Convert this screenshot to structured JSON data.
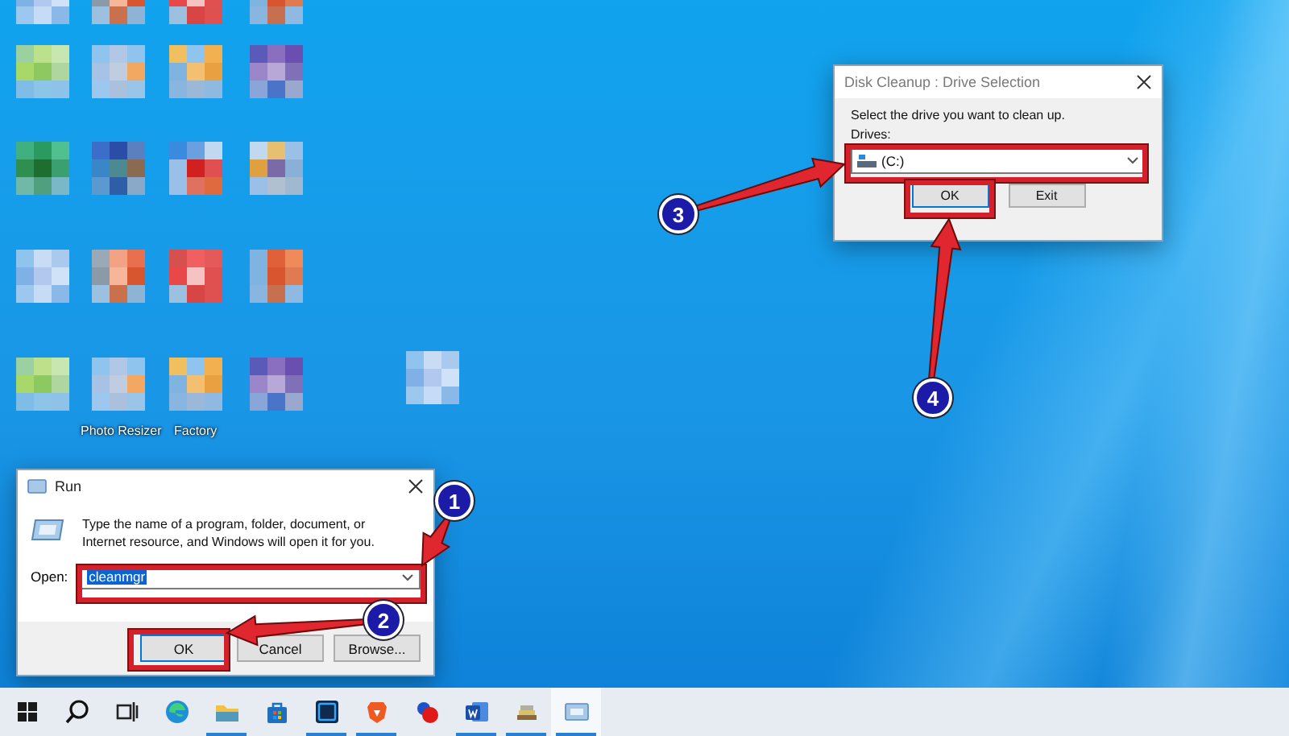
{
  "desktop_icons": [
    {
      "label": "Photo Resizer"
    },
    {
      "label": "Factory"
    }
  ],
  "run_dialog": {
    "title": "Run",
    "message": "Type the name of a program, folder, document, or Internet resource, and Windows will open it for you.",
    "open_label": "Open:",
    "open_value": "cleanmgr",
    "value_selected": true,
    "buttons": [
      {
        "label": "OK",
        "highlighted": true
      },
      {
        "label": "Cancel",
        "highlighted": false
      },
      {
        "label": "Browse...",
        "highlighted": false
      }
    ]
  },
  "disk_cleanup_dialog": {
    "title": "Disk Cleanup : Drive Selection",
    "prompt": "Select the drive you want to clean up.",
    "drives_label": "Drives:",
    "drive_value": "(C:)",
    "buttons": [
      {
        "label": "OK",
        "highlighted": true
      },
      {
        "label": "Exit",
        "highlighted": false
      }
    ]
  },
  "step_markers": [
    {
      "number": "1"
    },
    {
      "number": "2"
    },
    {
      "number": "3"
    },
    {
      "number": "4"
    }
  ],
  "taskbar": {
    "items": [
      {
        "kind": "start",
        "open": false,
        "selected": false
      },
      {
        "kind": "search",
        "open": false,
        "selected": false
      },
      {
        "kind": "taskview",
        "open": false,
        "selected": false
      },
      {
        "kind": "edge",
        "open": false,
        "selected": false
      },
      {
        "kind": "explorer",
        "open": true,
        "selected": false
      },
      {
        "kind": "store",
        "open": false,
        "selected": false
      },
      {
        "kind": "photoshop",
        "open": true,
        "selected": false
      },
      {
        "kind": "brave",
        "open": true,
        "selected": false
      },
      {
        "kind": "app",
        "open": false,
        "selected": false
      },
      {
        "kind": "word",
        "open": true,
        "selected": false
      },
      {
        "kind": "archive",
        "open": true,
        "selected": false
      },
      {
        "kind": "run",
        "open": true,
        "selected": true
      }
    ]
  }
}
